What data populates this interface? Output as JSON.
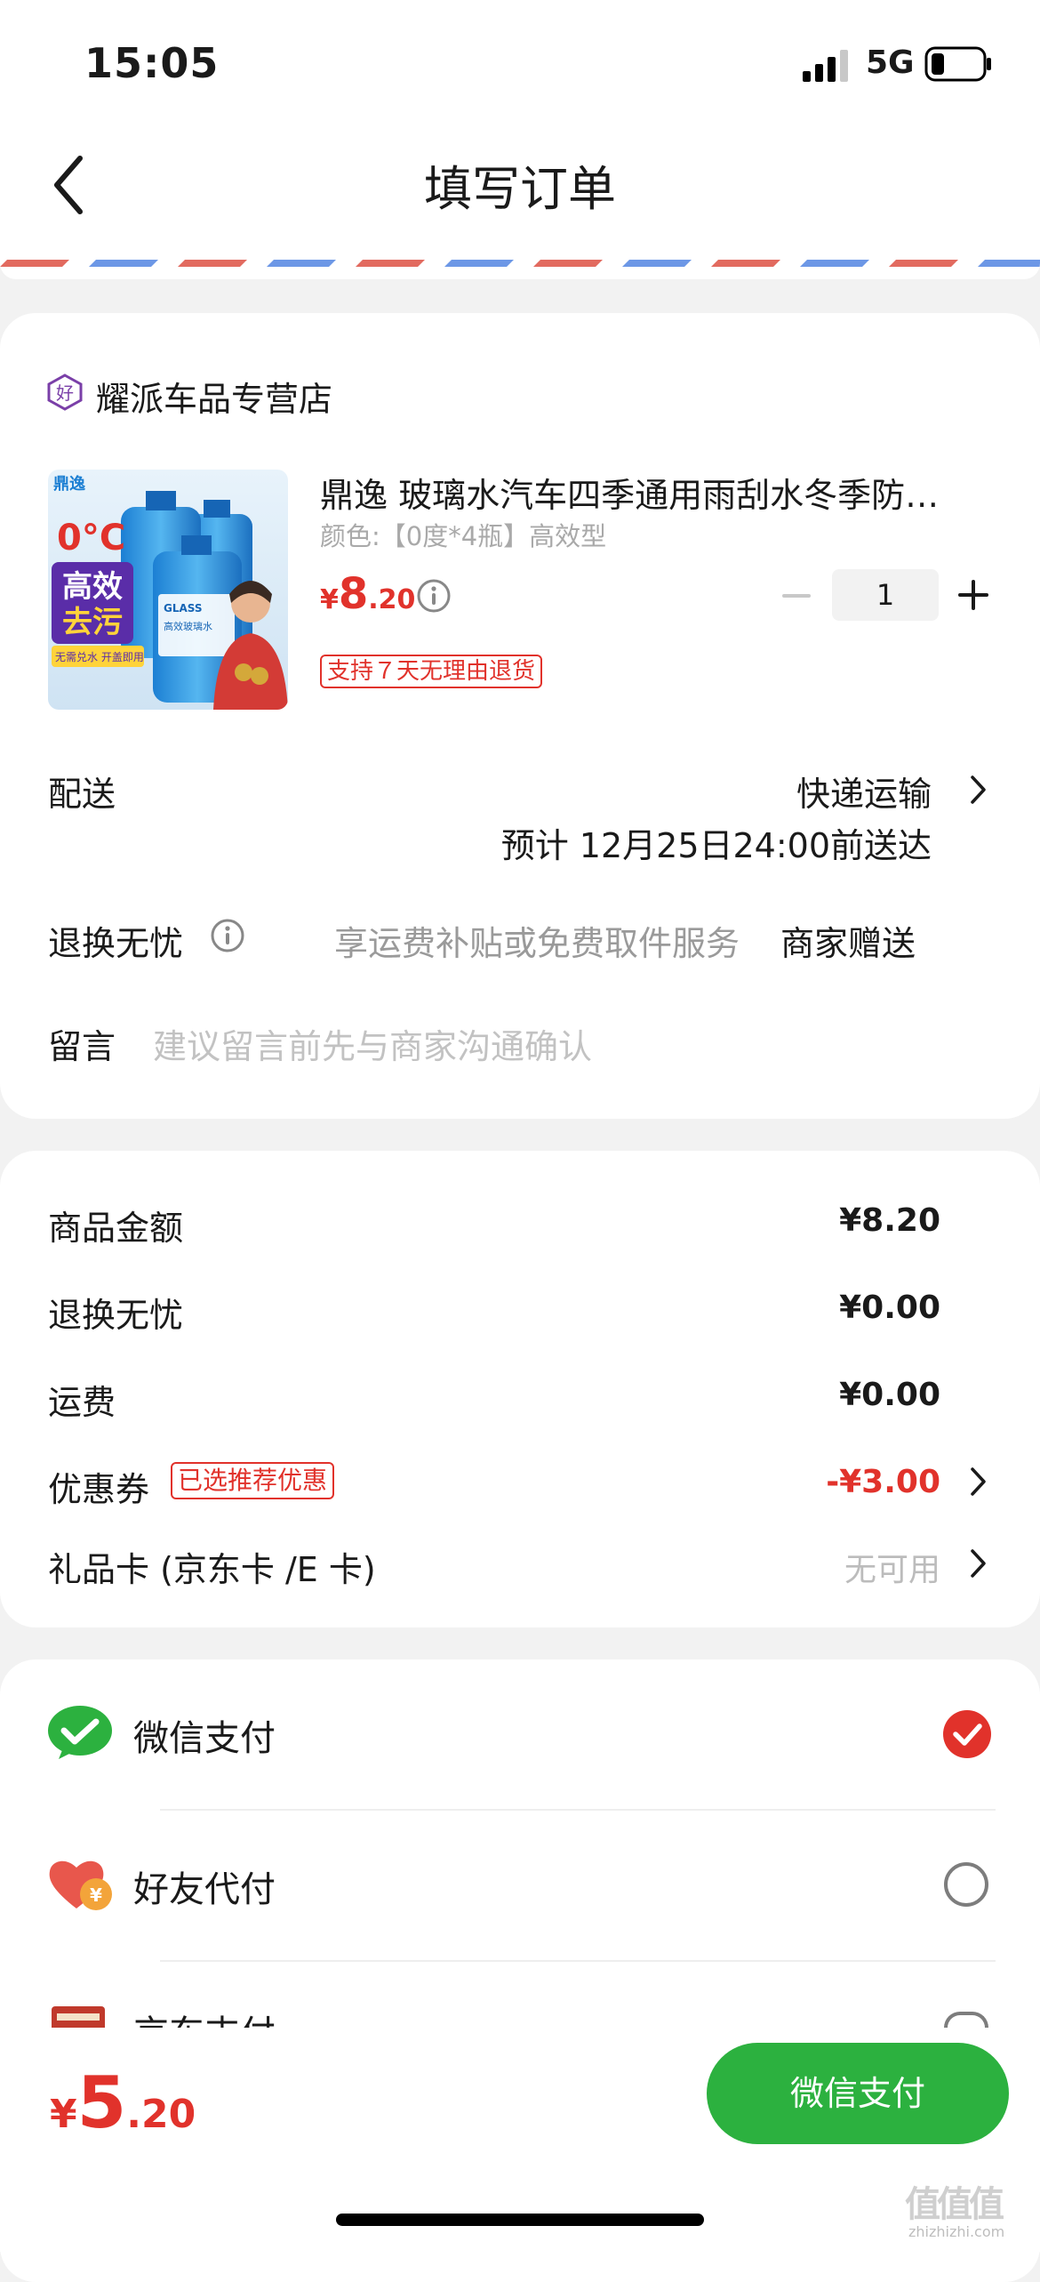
{
  "status_bar": {
    "time": "15:05",
    "network": "5G"
  },
  "nav": {
    "title": "填写订单"
  },
  "store": {
    "name": "耀派车品专营店",
    "badge_icon": "store-good-icon"
  },
  "product": {
    "title": "鼎逸 玻璃水汽车四季通用雨刮水冬季防…",
    "variant": "颜色:【0度*4瓶】高效型",
    "price_currency": "¥",
    "price_int": "8",
    "price_dec": ".20",
    "quantity": "1",
    "return_tag": "支持７天无理由退货",
    "image": {
      "brand": "鼎逸",
      "temp": "0°C",
      "slogan_line1": "高效",
      "slogan_line2": "去污",
      "sub": "无需兑水 开盖即用",
      "bottle_label": "GLASS",
      "bottle_label_cn": "高效玻璃水"
    }
  },
  "delivery": {
    "label": "配送",
    "method": "快递运输",
    "eta": "预计 12月25日24:00前送达"
  },
  "worry_free": {
    "label": "退换无忧",
    "desc": "享运费补贴或免费取件服务",
    "value": "商家赠送"
  },
  "message": {
    "label": "留言",
    "placeholder": "建议留言前先与商家沟通确认"
  },
  "costs": {
    "goods_label": "商品金额",
    "goods_value": "¥8.20",
    "worry_label": "退换无忧",
    "worry_value": "¥0.00",
    "shipping_label": "运费",
    "shipping_value": "¥0.00",
    "coupon_label": "优惠券",
    "coupon_tag": "已选推荐优惠",
    "coupon_value": "-¥3.00",
    "giftcard_label": "礼品卡 (京东卡 /E 卡)",
    "giftcard_value": "无可用"
  },
  "payment": {
    "options": [
      {
        "label": "微信支付",
        "icon": "wechat-pay-icon",
        "selected": true
      },
      {
        "label": "好友代付",
        "icon": "friend-pay-icon",
        "selected": false
      },
      {
        "label": "京东支付",
        "icon": "card-pay-icon",
        "selected": false
      }
    ]
  },
  "bottom": {
    "currency": "¥",
    "total_int": "5",
    "total_dec": ".20",
    "pay_button": "微信支付"
  },
  "watermark": {
    "text": "值值值",
    "url": "zhizhizhi.com"
  },
  "colors": {
    "accent_red": "#e1322b",
    "wechat_green": "#2cb13f"
  }
}
